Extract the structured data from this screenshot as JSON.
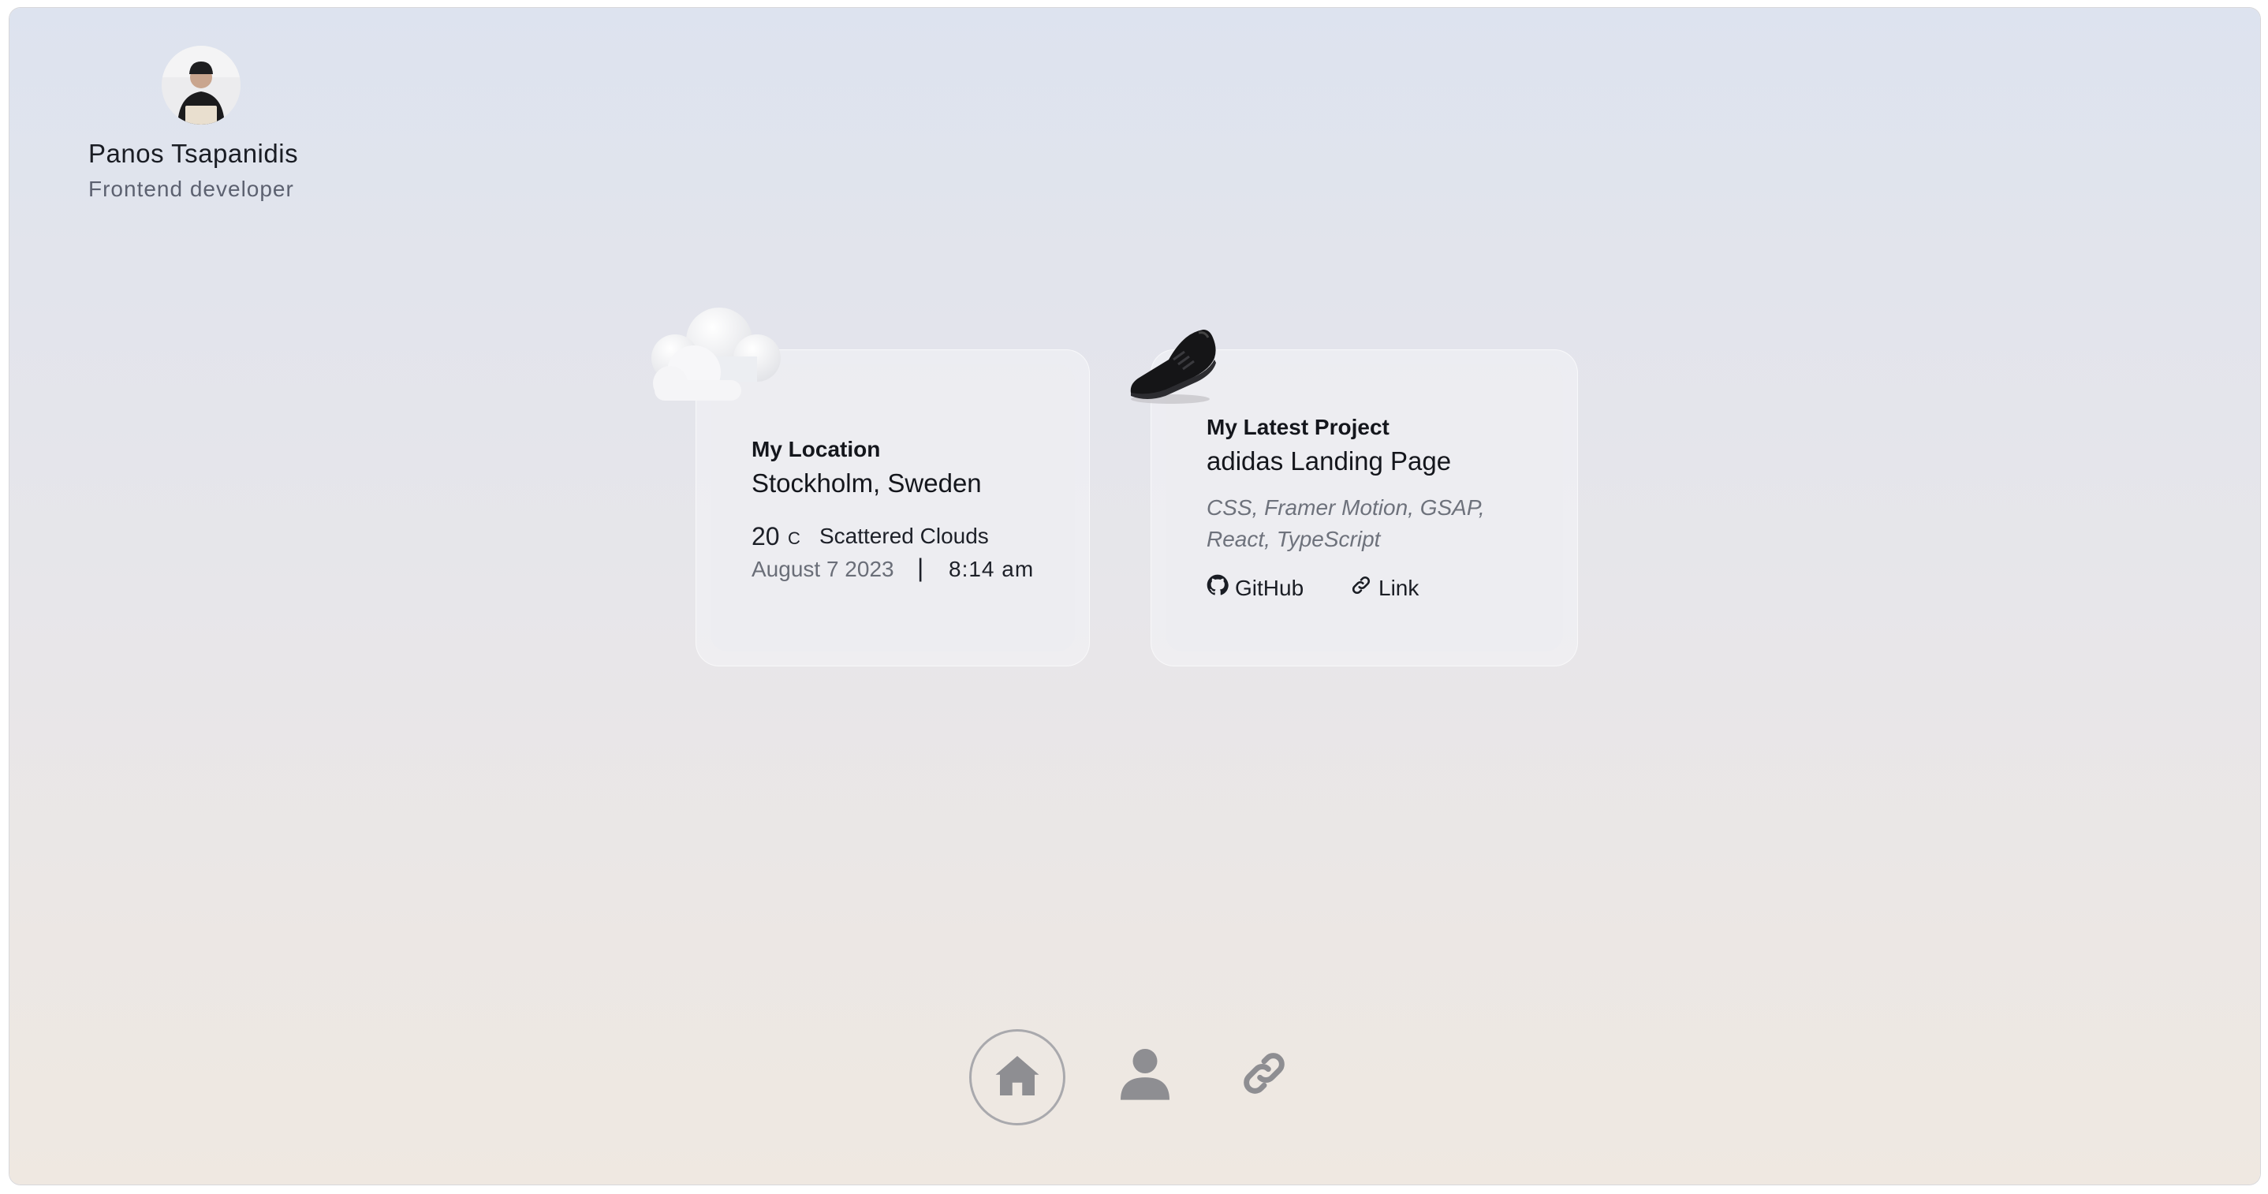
{
  "profile": {
    "name": "Panos Tsapanidis",
    "role": "Frontend developer",
    "avatar_icon": "avatar-photo"
  },
  "location_card": {
    "label": "My Location",
    "city": "Stockholm, Sweden",
    "temperature": "20",
    "unit": "C",
    "condition": "Scattered Clouds",
    "date": "August 7 2023",
    "separator": "|",
    "time": "8:14 am",
    "icon": "cloud-icon"
  },
  "project_card": {
    "label": "My Latest Project",
    "title": "adidas Landing Page",
    "tech_line1": "CSS, Framer Motion, GSAP,",
    "tech_line2": "React, TypeScript",
    "github_label": "GitHub",
    "link_label": "Link",
    "icon": "sneaker-icon"
  },
  "nav": {
    "items": [
      {
        "name": "home",
        "icon": "home-icon",
        "active": true
      },
      {
        "name": "about",
        "icon": "user-icon",
        "active": false
      },
      {
        "name": "links",
        "icon": "link-icon",
        "active": false
      }
    ]
  },
  "colors": {
    "bg_top": "#dde3ef",
    "bg_bottom": "#efe8e1",
    "text": "#14161c",
    "muted": "#6a6e78",
    "nav_icon": "#8e8e92"
  }
}
